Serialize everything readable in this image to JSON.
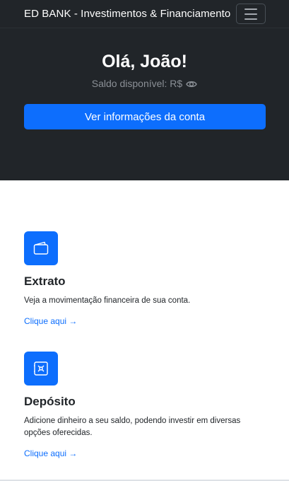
{
  "navbar": {
    "brand": "ED BANK - Investimentos & Financiamento",
    "menu_icon": "hamburger-icon"
  },
  "hero": {
    "greeting": "Olá, João!",
    "balance_label": "Saldo disponível: R$",
    "eye_icon": "eye-icon",
    "account_button_label": "Ver informações da conta"
  },
  "features": [
    {
      "icon": "wallet-icon",
      "title": "Extrato",
      "description": "Veja a movimentação financeira de sua conta.",
      "link_label": "Clique aqui →"
    },
    {
      "icon": "safe-icon",
      "title": "Depósito",
      "description": "Adicione dinheiro a seu saldo, podendo investir em diversas opções oferecidas.",
      "link_label": "Clique aqui →"
    }
  ],
  "colors": {
    "dark_bg": "#212529",
    "primary": "#0d6efd",
    "muted_text": "#8b9096"
  }
}
